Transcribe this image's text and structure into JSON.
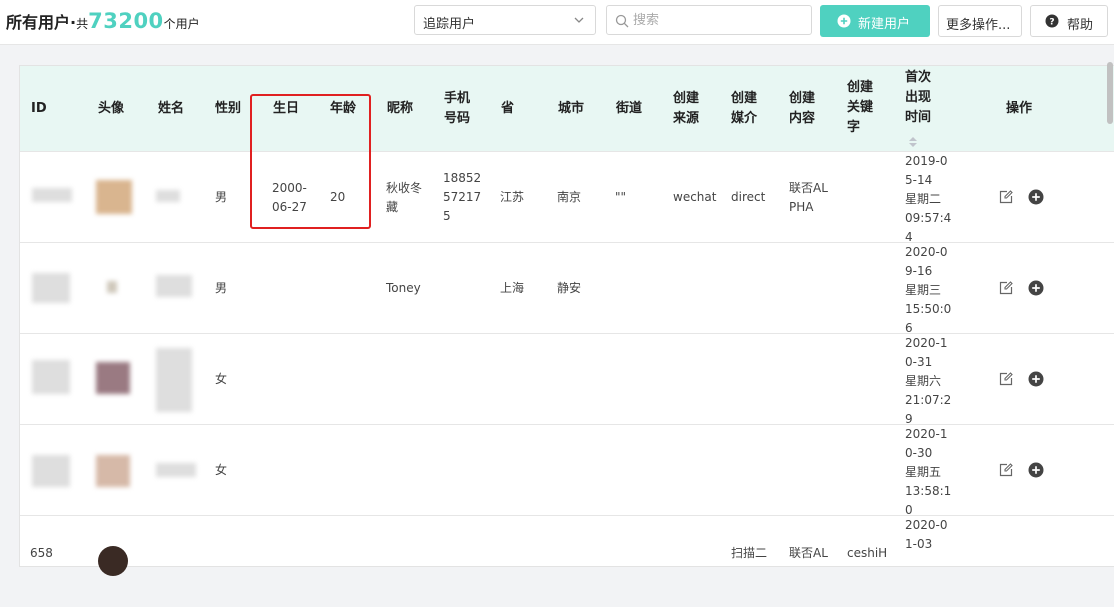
{
  "header": {
    "title": "所有用户·",
    "count_prefix": "共",
    "user_count": "73200",
    "count_suffix": "个用户"
  },
  "toolbar": {
    "filter_select": "追踪用户",
    "search_placeholder": "搜索",
    "new_user_label": "新建用户",
    "more_label": "更多操作...",
    "help_label": "帮助"
  },
  "table": {
    "columns": {
      "id": "ID",
      "avatar": "头像",
      "name": "姓名",
      "gender": "性别",
      "birthday": "生日",
      "age": "年龄",
      "nickname": "昵称",
      "phone": "手机\n号码",
      "province": "省",
      "city": "城市",
      "street": "街道",
      "source": "创建\n来源",
      "medium": "创建\n媒介",
      "content": "创建\n内容",
      "keyword": "创建\n关键\n字",
      "first_seen": "首次\n出现\n时间",
      "actions": "操作"
    },
    "rows": [
      {
        "gender": "男",
        "birthday": "2000-\n06-27",
        "age": "20",
        "nickname": "秋收冬\n藏",
        "phone": "18852\n57217\n5",
        "province": "江苏",
        "city": "南京",
        "street": "\"\"",
        "source": "wechat",
        "medium": "direct",
        "content": "联否AL\nPHA",
        "keyword": "",
        "first_seen": "2019-0\n5-14\n星期二\n09:57:4\n4"
      },
      {
        "gender": "男",
        "birthday": "",
        "age": "",
        "nickname": "Toney",
        "phone": "",
        "province": "上海",
        "city": "静安",
        "street": "",
        "source": "",
        "medium": "",
        "content": "",
        "keyword": "",
        "first_seen": "2020-0\n9-16\n星期三\n15:50:0\n6"
      },
      {
        "gender": "女",
        "birthday": "",
        "age": "",
        "nickname": "",
        "phone": "",
        "province": "",
        "city": "",
        "street": "",
        "source": "",
        "medium": "",
        "content": "",
        "keyword": "",
        "first_seen": "2020-1\n0-31\n星期六\n21:07:2\n9"
      },
      {
        "gender": "女",
        "birthday": "",
        "age": "",
        "nickname": "",
        "phone": "",
        "province": "",
        "city": "",
        "street": "",
        "source": "",
        "medium": "",
        "content": "",
        "keyword": "",
        "first_seen": "2020-1\n0-30\n星期五\n13:58:1\n0"
      },
      {
        "id": "658",
        "gender": "",
        "birthday": "",
        "age": "",
        "nickname": "",
        "phone": "",
        "province": "",
        "city": "",
        "street": "",
        "source": "",
        "medium": "扫描二",
        "content": "联否AL",
        "keyword": "ceshiH",
        "first_seen": "2020-0\n1-03"
      }
    ]
  },
  "colors": {
    "accent": "#4fd1c0",
    "header_bg": "#e8f7f3",
    "highlight": "#e02020"
  },
  "icons": [
    "chevron-down-icon",
    "search-icon",
    "plus-circle-icon",
    "help-icon",
    "edit-icon",
    "sort-icon"
  ]
}
